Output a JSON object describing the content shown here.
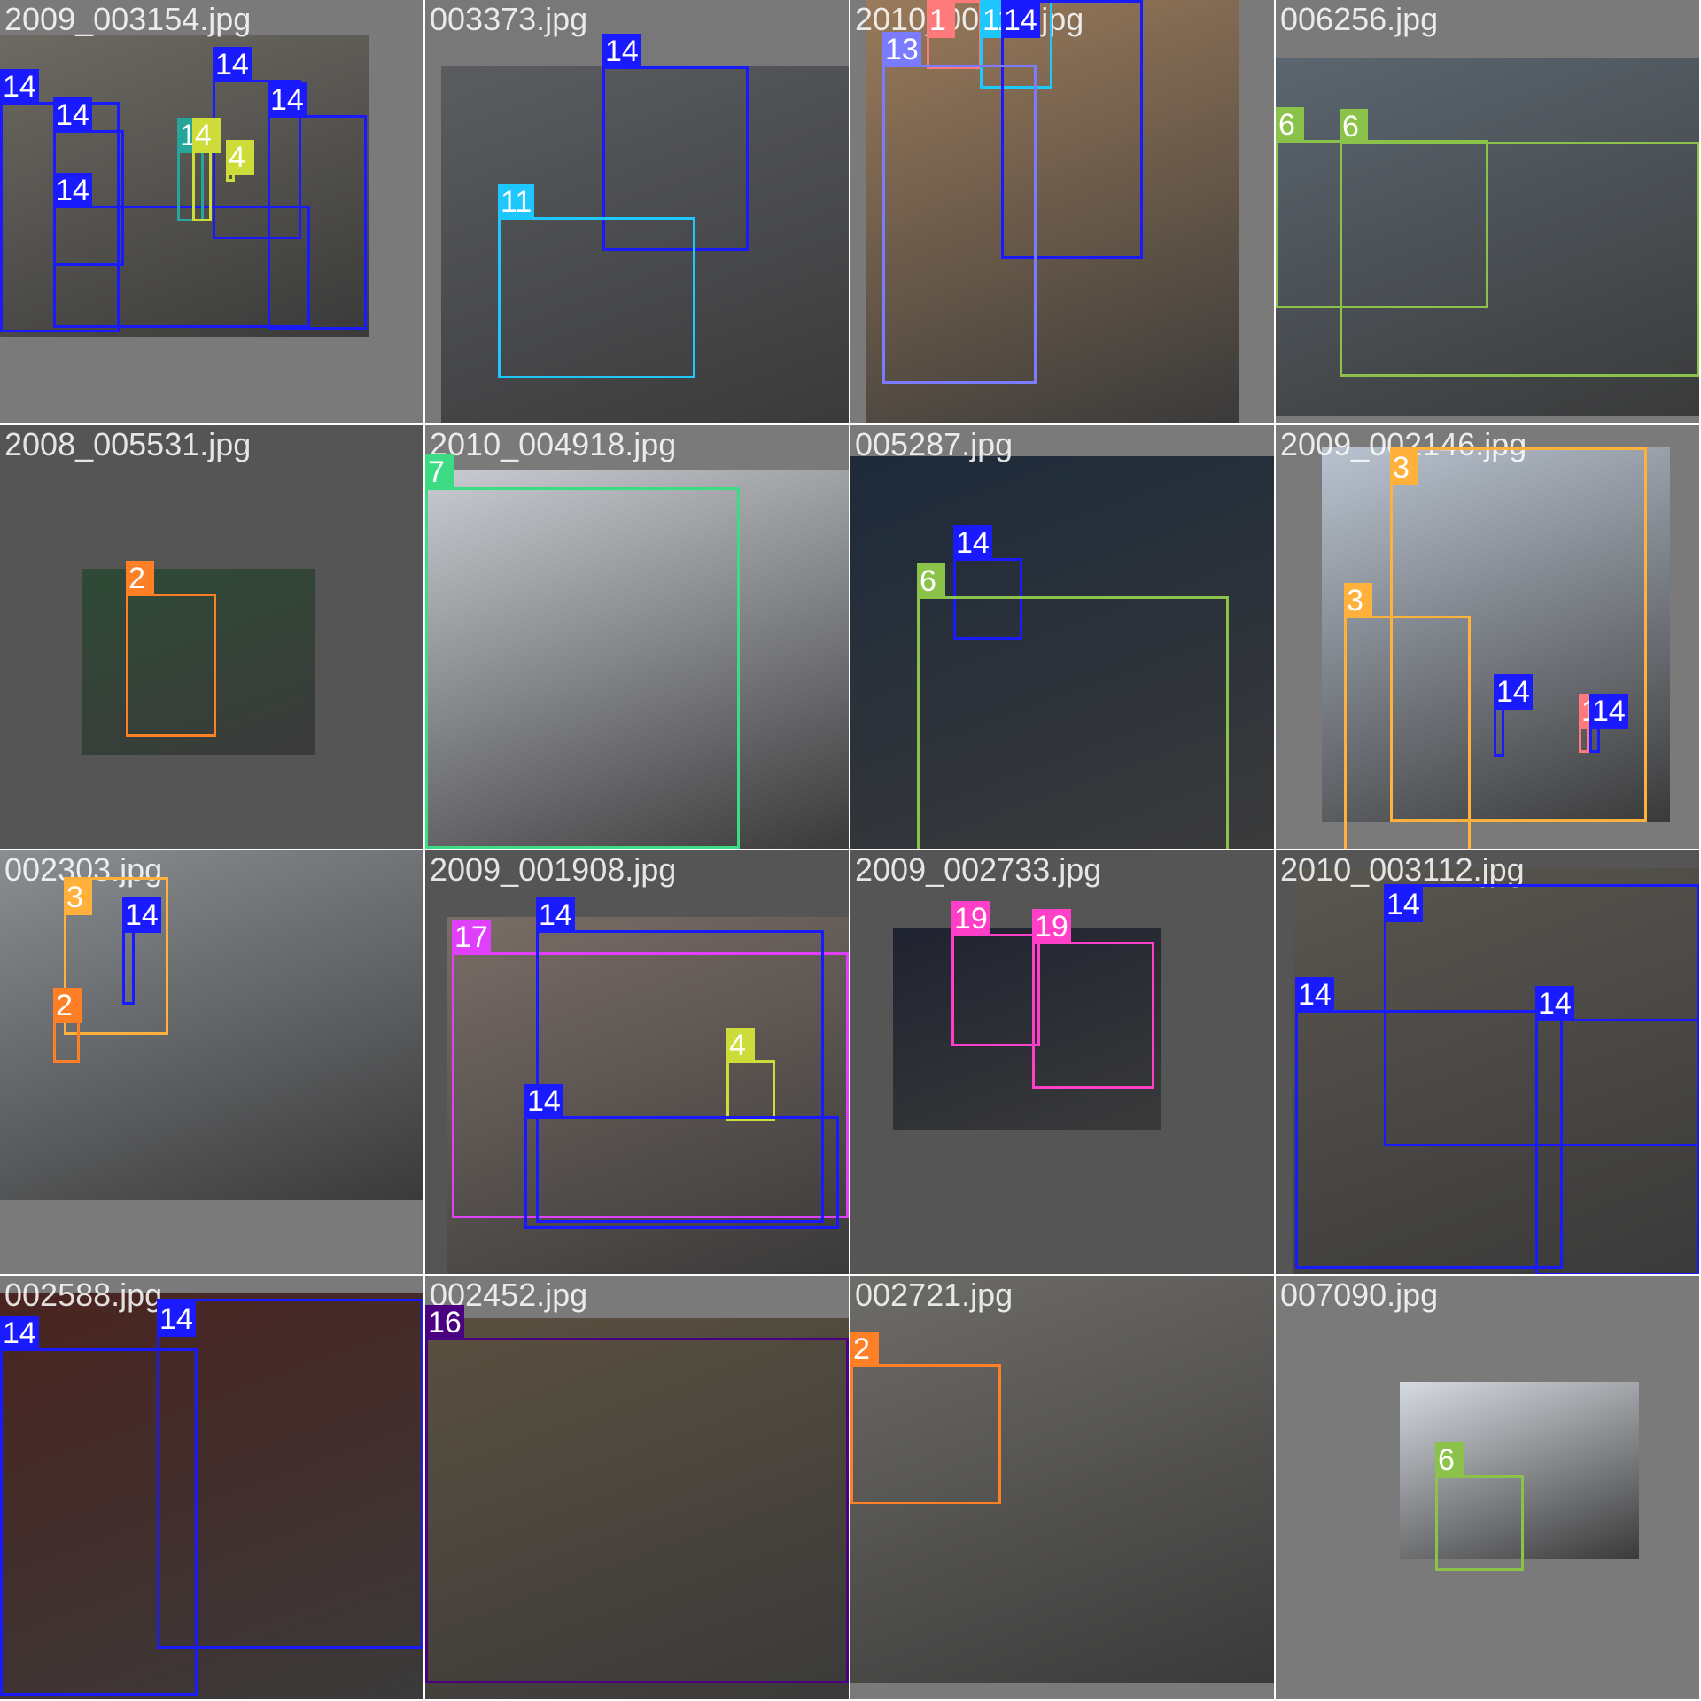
{
  "palette": {
    "2": "#ff7f27",
    "3": "#ffb13b",
    "4": "#cddc39",
    "6": "#8bc34a",
    "7": "#3ddc84",
    "10": "#26a69a",
    "11": "#1ec8ff",
    "13": "#7b7bff",
    "14": "#1a1aff",
    "16": "#4b0082",
    "17": "#e040fb",
    "19": "#ff3fc8",
    "1": "#ff7b7b"
  },
  "tiles": [
    {
      "filename": "2009_003154.jpg",
      "bg": "#7a7a7a",
      "photo_color": "#6d6a62",
      "labels": [
        "14",
        "14",
        "14",
        "14",
        "14",
        "10",
        "4",
        "4"
      ]
    },
    {
      "filename": "003373.jpg",
      "bg": "#787878",
      "photo_color": "#5a5c60",
      "labels": [
        "14",
        "11"
      ]
    },
    {
      "filename": "2010_00145.jpg",
      "bg": "#7a7a7a",
      "photo_color": "#9a7a5a",
      "labels": [
        "1",
        "11",
        "14",
        "13"
      ]
    },
    {
      "filename": "006256.jpg",
      "bg": "#7a7a7a",
      "photo_color": "#5b6670",
      "labels": [
        "6",
        "6"
      ]
    },
    {
      "filename": "2008_005531.jpg",
      "bg": "#555555",
      "photo_color": "#2f4a36",
      "labels": [
        "2"
      ]
    },
    {
      "filename": "2010_004918.jpg",
      "bg": "#7a7a7a",
      "photo_color": "#c9ccd2",
      "labels": [
        "7"
      ]
    },
    {
      "filename": "005287.jpg",
      "bg": "#7a7a7a",
      "photo_color": "#1d2a3a",
      "labels": [
        "14",
        "6"
      ]
    },
    {
      "filename": "2009_002146.jpg",
      "bg": "#7a7a7a",
      "photo_color": "#b9c3d0",
      "labels": [
        "3",
        "3",
        "14",
        "1",
        "14"
      ]
    },
    {
      "filename": "002303.jpg",
      "bg": "#7a7a7a",
      "photo_color": "#8a8e92",
      "labels": [
        "3",
        "14",
        "2"
      ]
    },
    {
      "filename": "2009_001908.jpg",
      "bg": "#555555",
      "photo_color": "#7a6d66",
      "labels": [
        "17",
        "14",
        "4",
        "14"
      ]
    },
    {
      "filename": "2009_002733.jpg",
      "bg": "#555555",
      "photo_color": "#1f2330",
      "labels": [
        "19",
        "19"
      ]
    },
    {
      "filename": "2010_003112.jpg",
      "bg": "#555555",
      "photo_color": "#5a5650",
      "labels": [
        "14",
        "14",
        "14"
      ]
    },
    {
      "filename": "002588.jpg",
      "bg": "#7a7a7a",
      "photo_color": "#4a2420",
      "labels": [
        "14",
        "14"
      ]
    },
    {
      "filename": "002452.jpg",
      "bg": "#7a7a7a",
      "photo_color": "#5a5040",
      "labels": [
        "16"
      ]
    },
    {
      "filename": "002721.jpg",
      "bg": "#7a7a7a",
      "photo_color": "#6e6c68",
      "labels": [
        "2"
      ]
    },
    {
      "filename": "007090.jpg",
      "bg": "#7a7a7a",
      "photo_color": "#d6dbe1",
      "labels": [
        "6"
      ]
    }
  ]
}
